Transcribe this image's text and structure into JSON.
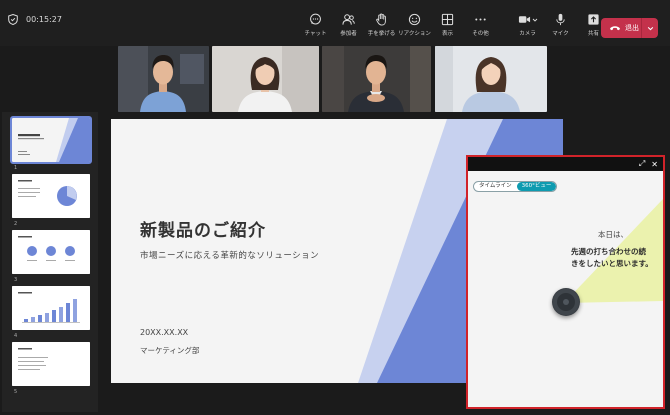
{
  "meeting": {
    "timer": "00:15:27"
  },
  "toolbar": {
    "chat": "チャット",
    "people": "参加者",
    "raise_hand": "手を挙げる",
    "reactions": "リアクション",
    "view": "表示",
    "more": "その他",
    "camera": "カメラ",
    "mic": "マイク",
    "share": "共有",
    "leave": "退出"
  },
  "slides": {
    "numbers": [
      "1",
      "2",
      "3",
      "4",
      "5"
    ],
    "selected": 1
  },
  "slide": {
    "title": "新製品のご紹介",
    "subtitle": "市場ニーズに応える革新的なソリューション",
    "date": "20XX.XX.XX",
    "department": "マーケティング部"
  },
  "panel": {
    "tabs": [
      "タイムライン",
      "360°ビュー"
    ],
    "active_tab": "360°ビュー",
    "greeting": "本日は、",
    "message": "先週の打ち合わせの続きをしたいと思います。"
  },
  "colors": {
    "accent_blue": "#6d86d6",
    "leave_red": "#c4314b",
    "highlight_border": "#d1232a",
    "tab_active": "#0e9bb0"
  }
}
